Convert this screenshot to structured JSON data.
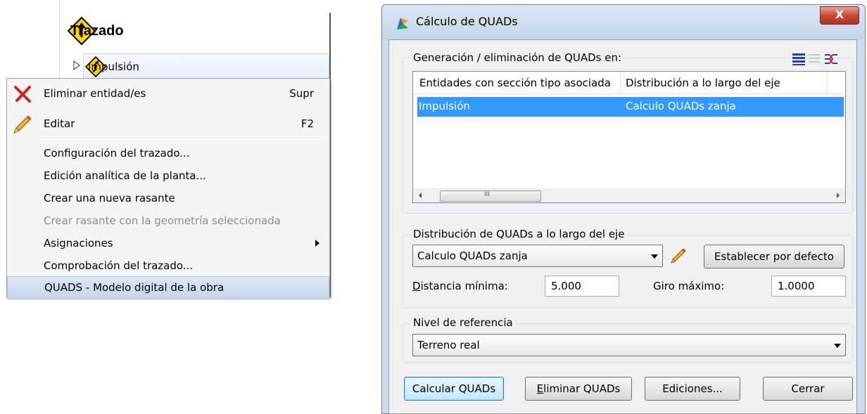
{
  "tree": {
    "root_label": "Trazado",
    "child_label": "Impulsión"
  },
  "context_menu": {
    "items": [
      {
        "label": "Eliminar entidad/es",
        "shortcut": "Supr",
        "icon": "red-x-icon"
      },
      {
        "label": "Editar",
        "shortcut": "F2",
        "icon": "pencil-icon"
      },
      {
        "label": "Configuración del trazado..."
      },
      {
        "label": "Edición analítica de la planta..."
      },
      {
        "label": "Crear una nueva rasante"
      },
      {
        "label": "Crear rasante con la geometría seleccionada",
        "disabled": true
      },
      {
        "label": "Asignaciones",
        "has_submenu": true
      },
      {
        "label": "Comprobación del trazado..."
      },
      {
        "label": "QUADS - Modelo digital de la obra",
        "highlighted": true
      }
    ]
  },
  "dialog": {
    "title": "Cálculo de QUADs",
    "close_label": "X",
    "generation_group": {
      "label": "Generación / eliminación de QUADs en:",
      "columns": [
        "Entidades con sección tipo asociada",
        "Distribución a lo largo del eje"
      ],
      "rows": [
        {
          "entity": "Impulsión",
          "distribution": "Calculo QUADs zanja",
          "selected": true
        }
      ]
    },
    "distribution_group": {
      "label": "Distribución de QUADs a lo largo del eje",
      "selected": "Calculo QUADs zanja",
      "set_default_label": "Establecer por defecto",
      "min_distance_label_first": "D",
      "min_distance_label_rest": "istancia mínima:",
      "min_distance_value": "5.000",
      "max_turn_label": "Giro máximo:",
      "max_turn_value": "1.0000"
    },
    "reference_group": {
      "label": "Nivel de referencia",
      "selected": "Terreno real"
    },
    "buttons": {
      "calculate": "Calcular QUADs",
      "delete_first": "E",
      "delete_rest": "liminar QUADs",
      "editions": "Ediciones...",
      "close": "Cerrar"
    }
  },
  "colors": {
    "selection": "#3399ff",
    "menu_highlight": "#c7d6ea",
    "close_button": "#c8483a"
  }
}
